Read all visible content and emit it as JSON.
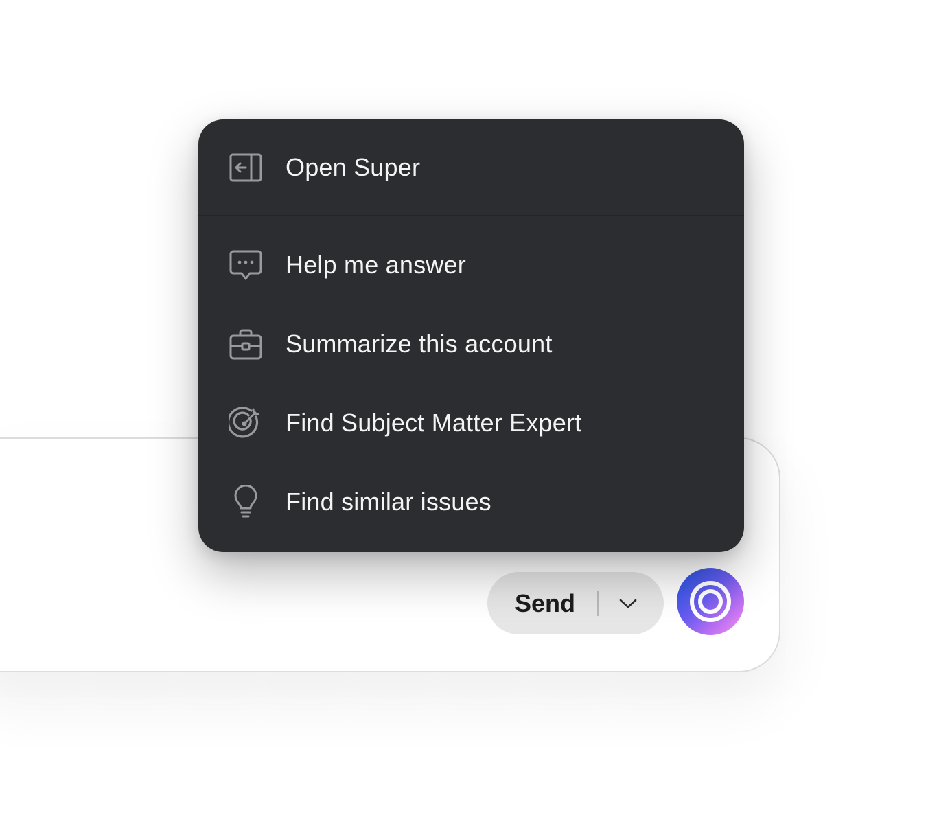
{
  "menu": {
    "items": [
      {
        "label": "Open Super",
        "icon": "panel-open-icon"
      },
      {
        "label": "Help me answer",
        "icon": "chat-bubble-dots-icon"
      },
      {
        "label": "Summarize this account",
        "icon": "briefcase-icon"
      },
      {
        "label": "Find Subject Matter Expert",
        "icon": "target-icon"
      },
      {
        "label": "Find similar issues",
        "icon": "lightbulb-icon"
      }
    ]
  },
  "composer": {
    "send_label": "Send",
    "dropdown_icon": "chevron-down-icon",
    "assistant_icon": "concentric-rings-icon"
  },
  "colors": {
    "menu_background": "#2c2d30",
    "menu_text": "#f4f4f5",
    "icon_stroke": "#9a9a9e",
    "send_background": "#e6e6e6",
    "assistant_gradient": [
      "#1f55e0",
      "#6a5cf0",
      "#c271f2",
      "#f59ae9"
    ]
  }
}
